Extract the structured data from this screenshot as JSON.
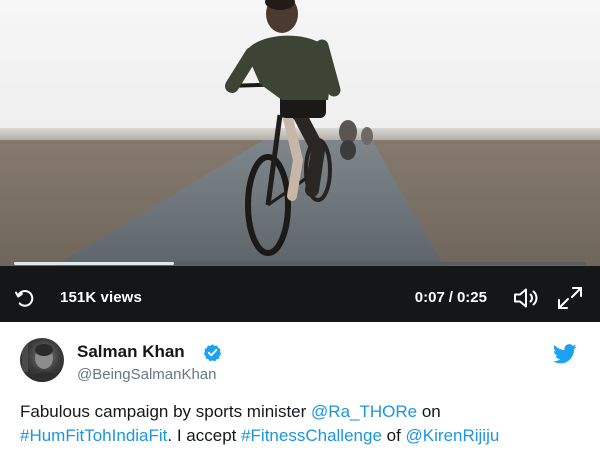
{
  "video": {
    "views": "151K views",
    "current_time": "0:07",
    "duration": "0:25",
    "time_separator": "/",
    "progress": 0.28,
    "icons": {
      "replay": "replay-icon",
      "volume": "volume-icon",
      "fullscreen": "fullscreen-icon"
    }
  },
  "tweet": {
    "display_name": "Salman Khan",
    "handle": "@BeingSalmanKhan",
    "verified": true,
    "text": {
      "line1": {
        "p1": "Fabulous campaign by sports minister ",
        "mention1": "@Ra_THORe",
        "p2": " on"
      },
      "line2": {
        "hashtag1": "#HumFitTohIndiaFit",
        "p3": ". I accept ",
        "hashtag2": "#FitnessChallenge",
        "p4": " of ",
        "mention2": "@KirenRijiju"
      }
    }
  },
  "colors": {
    "link": "#1b95e0",
    "verified": "#1da1f2",
    "twitter_brand": "#1da1f2",
    "video_bar": "#151618",
    "handle": "#657786",
    "text": "#14171a"
  }
}
